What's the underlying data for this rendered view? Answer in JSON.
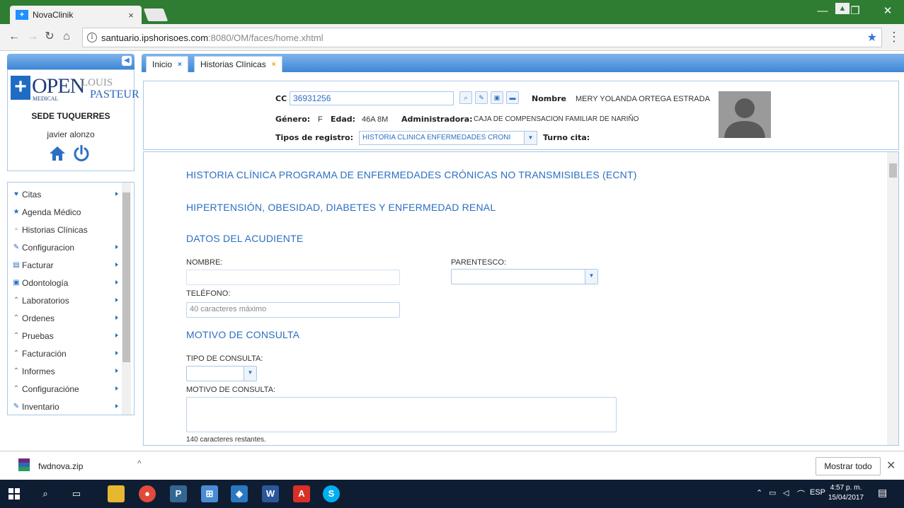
{
  "browser": {
    "tab_title": "NovaClinik",
    "tab_close": "×",
    "url_host": "santuario.ipshorisoes.com",
    "url_path": ":8080/OM/faces/home.xhtml",
    "window_min": "—",
    "window_restore": "❐",
    "window_close": "✕"
  },
  "sidebar": {
    "logo": {
      "open": "OPEN",
      "medical": "MEDICAL",
      "louis": "LOUIS",
      "pasteur": "PASTEUR"
    },
    "sede": "SEDE TUQUERRES",
    "user": "javier alonzo",
    "menu": [
      {
        "label": "Citas",
        "icon": "♥"
      },
      {
        "label": "Agenda Médico",
        "icon": "★"
      },
      {
        "label": "Historias Clínicas",
        "icon": "▫"
      },
      {
        "label": "Configuracion",
        "icon": "✎"
      },
      {
        "label": "Facturar",
        "icon": "▤"
      },
      {
        "label": "Odontología",
        "icon": "▣"
      },
      {
        "label": "Laboratorios",
        "icon": "⌃"
      },
      {
        "label": "Ordenes",
        "icon": "⌃"
      },
      {
        "label": "Pruebas",
        "icon": "⌃"
      },
      {
        "label": "Facturación",
        "icon": "⌃"
      },
      {
        "label": "Informes",
        "icon": "⌃"
      },
      {
        "label": "Configuracióne",
        "icon": "⌃"
      },
      {
        "label": "Inventario",
        "icon": "✎"
      }
    ]
  },
  "tabs": [
    {
      "label": "Inicio",
      "close": "×"
    },
    {
      "label": "Historias Clínicas",
      "close": "×"
    }
  ],
  "patient": {
    "cc_label": "CC",
    "cc_value": "36931256",
    "nombre_label": "Nombre",
    "nombre_value": "MERY YOLANDA ORTEGA ESTRADA",
    "genero_label": "Género:",
    "genero_value": "F",
    "edad_label": "Edad:",
    "edad_value": "46A 8M",
    "admin_label": "Administradora:",
    "admin_value": "CAJA DE COMPENSACION FAMILIAR DE NARIÑO",
    "tipos_label": "Tipos de registro:",
    "tipos_value": "HISTORIA CLINICA ENFERMEDADES CRONI",
    "turno_label": "Turno cita:"
  },
  "form": {
    "title1": "HISTORIA CLÍNICA PROGRAMA DE ENFERMEDADES CRÓNICAS NO TRANSMISIBLES (ECNT)",
    "title2": "HIPERTENSIÓN, OBESIDAD, DIABETES Y ENFERMEDAD RENAL",
    "section_acudiente": "DATOS DEL ACUDIENTE",
    "nombre_label": "NOMBRE:",
    "parentesco_label": "PARENTESCO:",
    "telefono_label": "TELÉFONO:",
    "telefono_placeholder": "40 caracteres máximo",
    "section_motivo": "MOTIVO DE CONSULTA",
    "tipo_consulta_label": "TIPO DE CONSULTA:",
    "motivo_label": "MOTIVO DE CONSULTA:",
    "motivo_counter": "140 caracteres restantes."
  },
  "downloads": {
    "file": "fwdnova.zip",
    "show_all": "Mostrar todo",
    "chevron": "^",
    "close": "✕"
  },
  "taskbar": {
    "time": "4:57 p. m.",
    "date": "15/04/2017",
    "lang": "ESP",
    "apps": [
      "windows-start",
      "search",
      "task-view",
      "file-explorer",
      "chrome",
      "pgadmin",
      "network-app",
      "virtualbox",
      "word",
      "acrobat",
      "skype"
    ]
  },
  "colors": {
    "accent": "#2b6fc2",
    "chrome_green": "#2f7d32",
    "taskbar": "#0f1d33"
  }
}
